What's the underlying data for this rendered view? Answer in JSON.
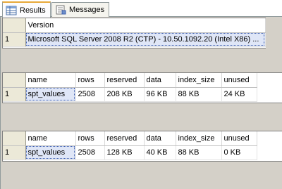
{
  "tabs": [
    {
      "label": "Results",
      "icon": "grid-icon",
      "active": true
    },
    {
      "label": "Messages",
      "icon": "messages-icon",
      "active": false
    }
  ],
  "result_sets": [
    {
      "columns": [
        "Version"
      ],
      "rows": [
        {
          "num": "1",
          "cells": [
            "Microsoft SQL Server 2008 R2 (CTP) - 10.50.1092.20 (Intel X86) ..."
          ]
        }
      ]
    },
    {
      "columns": [
        "name",
        "rows",
        "reserved",
        "data",
        "index_size",
        "unused"
      ],
      "rows": [
        {
          "num": "1",
          "cells": [
            "spt_values",
            "2508",
            "208 KB",
            "96 KB",
            "88 KB",
            "24 KB"
          ]
        }
      ]
    },
    {
      "columns": [
        "name",
        "rows",
        "reserved",
        "data",
        "index_size",
        "unused"
      ],
      "rows": [
        {
          "num": "1",
          "cells": [
            "spt_values",
            "2508",
            "128 KB",
            "40 KB",
            "88 KB",
            "0 KB"
          ]
        }
      ]
    }
  ],
  "colors": {
    "active_tab_accent": "#e8a93a",
    "selected_cell": "#dfe6f7",
    "row_header": "#ece9d8",
    "pane_background": "#d4d0c8"
  }
}
